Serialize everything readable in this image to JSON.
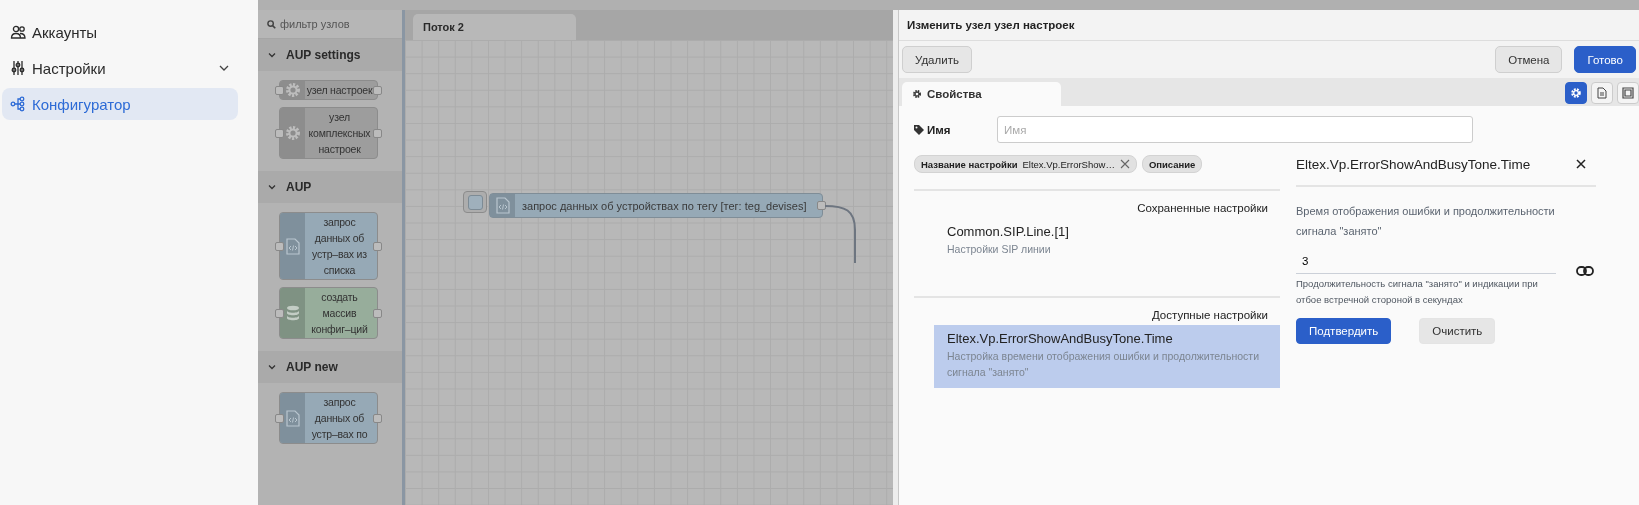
{
  "sidebar": {
    "items": [
      {
        "label": "Аккаунты",
        "kind": "link",
        "selected": false
      },
      {
        "label": "Настройки",
        "kind": "group",
        "selected": false
      },
      {
        "label": "Конфигуратор",
        "kind": "link",
        "selected": true
      }
    ]
  },
  "palette": {
    "filter_placeholder": "фильтр узлов",
    "categories": [
      {
        "title": "AUP settings",
        "expanded": true,
        "nodes": [
          {
            "label": "узел настроек",
            "kind": "settings"
          },
          {
            "label": "узел комплексных настроек",
            "kind": "settings"
          }
        ]
      },
      {
        "title": "AUP",
        "expanded": true,
        "nodes": [
          {
            "label": "запрос данных об устр–вах из списка",
            "kind": "function"
          },
          {
            "label": "создать массив конфиг–ций",
            "kind": "database"
          }
        ]
      },
      {
        "title": "AUP new",
        "expanded": true,
        "nodes": [
          {
            "label": "запрос данных об устр–вах по",
            "kind": "function"
          }
        ]
      }
    ]
  },
  "workspace": {
    "tabs": [
      {
        "label": "Поток 2",
        "selected": true
      }
    ],
    "nodes": [
      {
        "label": "запрос данных об устройствах по тегу [тег: teg_devises]",
        "kind": "function"
      }
    ]
  },
  "editor": {
    "title": "Изменить узел узел настроек",
    "buttons": [
      {
        "label": "Удалить",
        "kind": "default"
      },
      {
        "label": "Отмена",
        "kind": "default"
      },
      {
        "label": "Готово",
        "kind": "primary"
      }
    ],
    "tabs": [
      {
        "label": "Свойства",
        "selected": true
      }
    ],
    "side_tabs": [
      {
        "selected": true
      },
      {
        "selected": false
      },
      {
        "selected": false
      }
    ],
    "name_field": {
      "label": "Имя",
      "placeholder": "Имя"
    },
    "chips": [
      {
        "label": "Название настройки",
        "value": "Eltex.Vp.ErrorShow…",
        "removable": true
      },
      {
        "label": "Описание",
        "removable": false
      }
    ],
    "saved": {
      "heading": "Сохраненные настройки",
      "items": [
        {
          "name": "Common.SIP.Line.[1]",
          "description": "Настройки SIP линии",
          "selected": false
        }
      ]
    },
    "available": {
      "heading": "Доступные настройки",
      "items": [
        {
          "name": "Eltex.Vp.ErrorShowAndBusyTone.Time",
          "description": "Настройка времени отображения ошибки и продолжительности сигнала \"занято\"",
          "selected": true
        }
      ]
    },
    "detail": {
      "title": "Eltex.Vp.ErrorShowAndBusyTone.Time",
      "description": "Время отображения ошибки и продолжительности сигнала \"занято\"",
      "value": "3",
      "hint": "Продолжительность сигнала \"занято\" и индикации при отбое встречной стороной в секундах",
      "buttons": [
        {
          "label": "Подтвердить",
          "kind": "primary"
        },
        {
          "label": "Очистить",
          "kind": "default"
        }
      ]
    }
  }
}
